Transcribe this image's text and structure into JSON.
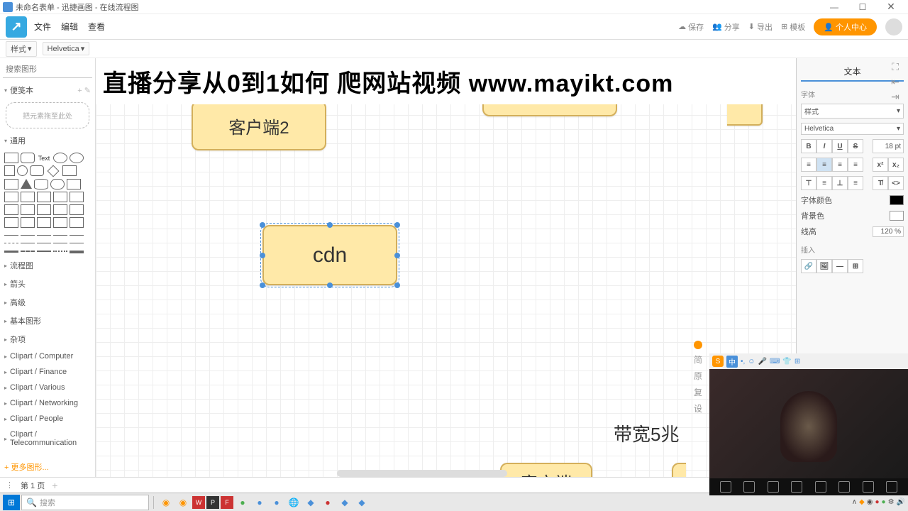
{
  "window": {
    "title": "未命名表单 - 迅捷画图 - 在线流程图"
  },
  "menus": {
    "file": "文件",
    "edit": "编辑",
    "view": "查看"
  },
  "topright": {
    "save": "保存",
    "share": "分享",
    "export": "导出",
    "template": "模板",
    "personal": "个人中心"
  },
  "toolbar": {
    "style": "样式",
    "font": "Helvetica"
  },
  "left": {
    "search_ph": "搜索图形",
    "scratch": "便笺本",
    "drop": "把元素拖至此处",
    "general": "通用",
    "cats": [
      "流程图",
      "箭头",
      "高级",
      "基本图形",
      "杂项",
      "Clipart / Computer",
      "Clipart / Finance",
      "Clipart / Various",
      "Clipart / Networking",
      "Clipart / People",
      "Clipart / Telecommunication"
    ],
    "more": "更多图形..."
  },
  "canvas": {
    "banner": "直播分享从0到1如何 爬网站视频 www.mayikt.com",
    "nodes": {
      "client2": "客户端2",
      "cdn": "cdn",
      "client": "客户端"
    },
    "annot": "带宽5兆"
  },
  "right": {
    "tab": "文本",
    "font_label": "字体",
    "style_sel": "样式",
    "font_sel": "Helvetica",
    "size": "18 pt",
    "fontcolor": "字体颜色",
    "bgcolor": "背景色",
    "lineheight_lbl": "线高",
    "lineheight": "120 %",
    "insert": "插入"
  },
  "page": {
    "tab": "第 1 页"
  },
  "taskbar": {
    "search": "搜索"
  },
  "ime": {
    "lang": "中"
  }
}
